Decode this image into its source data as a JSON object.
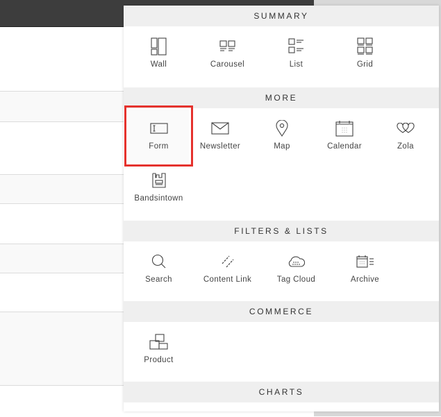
{
  "panel": {
    "sections": [
      {
        "title": "SUMMARY",
        "items": [
          {
            "label": "Wall",
            "icon": "wall-icon"
          },
          {
            "label": "Carousel",
            "icon": "carousel-icon"
          },
          {
            "label": "List",
            "icon": "list-icon"
          },
          {
            "label": "Grid",
            "icon": "grid-icon"
          }
        ]
      },
      {
        "title": "MORE",
        "items": [
          {
            "label": "Form",
            "icon": "form-icon",
            "highlighted": true
          },
          {
            "label": "Newsletter",
            "icon": "envelope-icon"
          },
          {
            "label": "Map",
            "icon": "map-pin-icon"
          },
          {
            "label": "Calendar",
            "icon": "calendar-icon"
          },
          {
            "label": "Zola",
            "icon": "hearts-icon"
          },
          {
            "label": "Bandsintown",
            "icon": "bandsintown-icon"
          }
        ]
      },
      {
        "title": "FILTERS & LISTS",
        "items": [
          {
            "label": "Search",
            "icon": "search-icon"
          },
          {
            "label": "Content Link",
            "icon": "link-icon"
          },
          {
            "label": "Tag Cloud",
            "icon": "cloud-icon"
          },
          {
            "label": "Archive",
            "icon": "archive-icon"
          }
        ]
      },
      {
        "title": "COMMERCE",
        "items": [
          {
            "label": "Product",
            "icon": "product-icon"
          }
        ]
      },
      {
        "title": "CHARTS",
        "items": []
      }
    ]
  },
  "colors": {
    "highlight": "#e5322d",
    "header_bg": "#efefef",
    "topbar": "#3d3d3d"
  }
}
